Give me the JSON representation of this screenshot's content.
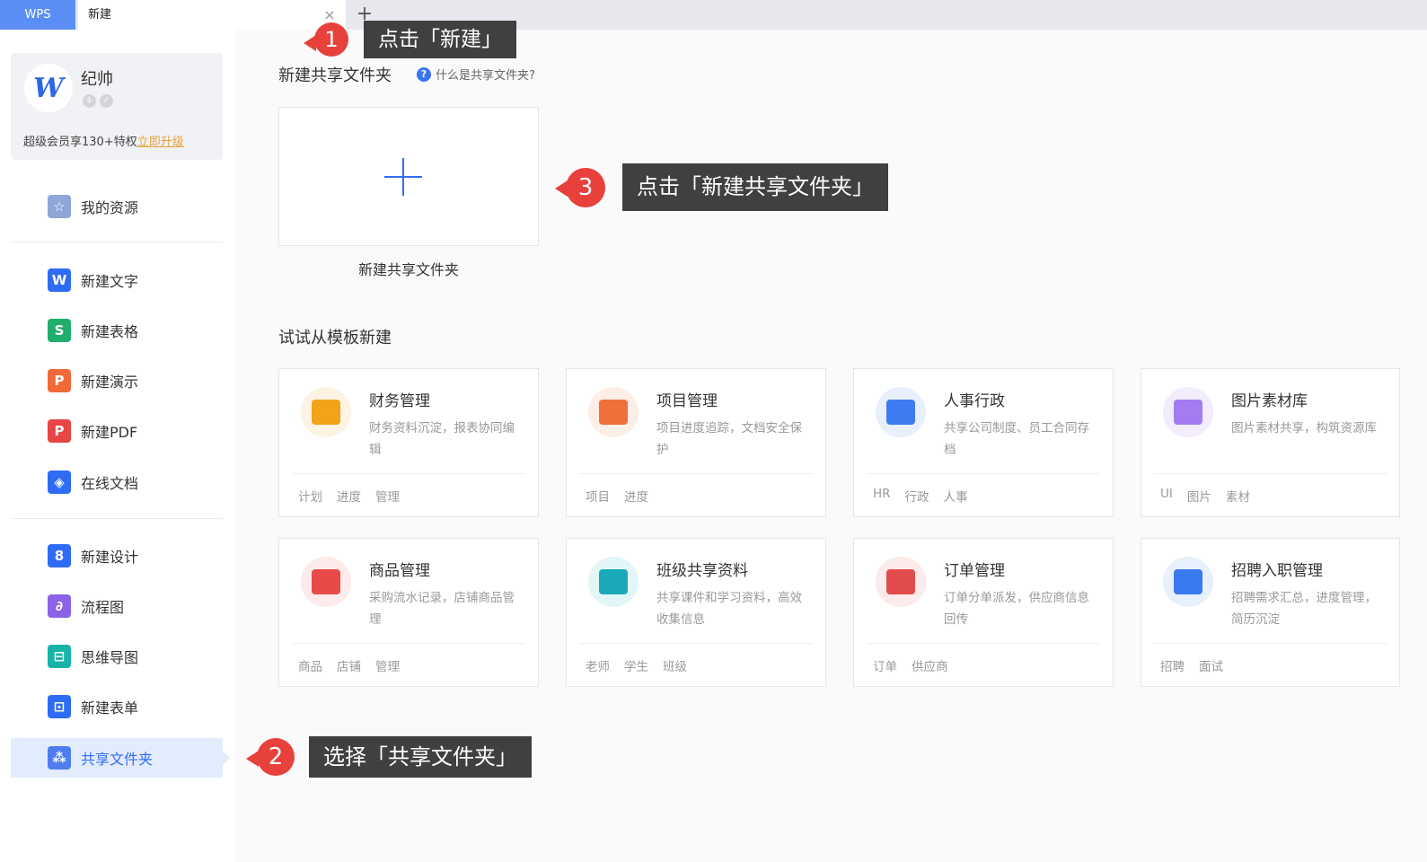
{
  "tabs": {
    "wps_label": "WPS",
    "active_label": "新建",
    "close_icon": "×",
    "add_icon": "+"
  },
  "profile": {
    "username": "纪帅",
    "vip_prefix": "超级会员享130+特权",
    "vip_link": "立即升级"
  },
  "sidebar": {
    "items": [
      {
        "label": "我的资源",
        "icon": "star-icon",
        "color": "#8ea6d8",
        "glyph": "☆"
      },
      {
        "label": "新建文字",
        "icon": "writer-icon",
        "color": "#2f6cf5",
        "glyph": "W"
      },
      {
        "label": "新建表格",
        "icon": "sheet-icon",
        "color": "#1fae6c",
        "glyph": "S"
      },
      {
        "label": "新建演示",
        "icon": "slides-icon",
        "color": "#f26a3a",
        "glyph": "P"
      },
      {
        "label": "新建PDF",
        "icon": "pdf-icon",
        "color": "#e84545",
        "glyph": "P"
      },
      {
        "label": "在线文档",
        "icon": "cloud-doc-icon",
        "color": "#2f6cf5",
        "glyph": "◈"
      },
      {
        "label": "新建设计",
        "icon": "design-icon",
        "color": "#2f6cf5",
        "glyph": "8"
      },
      {
        "label": "流程图",
        "icon": "flowchart-icon",
        "color": "#8a63e6",
        "glyph": "∂"
      },
      {
        "label": "思维导图",
        "icon": "mindmap-icon",
        "color": "#17b3a6",
        "glyph": "⊟"
      },
      {
        "label": "新建表单",
        "icon": "form-icon",
        "color": "#2f6cf5",
        "glyph": "⊡"
      },
      {
        "label": "共享文件夹",
        "icon": "shared-folder-icon",
        "color": "#4f7df0",
        "glyph": "⁂"
      }
    ]
  },
  "main": {
    "shared_title": "新建共享文件夹",
    "help_text": "什么是共享文件夹?",
    "new_card_label": "新建共享文件夹",
    "template_title": "试试从模板新建",
    "templates": [
      {
        "name": "财务管理",
        "desc": "财务资料沉淀，报表协同编辑",
        "tags": [
          "计划",
          "进度",
          "管理"
        ],
        "bg": "#fdf3e2",
        "color": "#f3a319"
      },
      {
        "name": "项目管理",
        "desc": "项目进度追踪，文档安全保护",
        "tags": [
          "项目",
          "进度"
        ],
        "bg": "#fdeee6",
        "color": "#f0703a"
      },
      {
        "name": "人事行政",
        "desc": "共享公司制度、员工合同存档",
        "tags": [
          "HR",
          "行政",
          "人事"
        ],
        "bg": "#e8f0fd",
        "color": "#3c7cf0"
      },
      {
        "name": "图片素材库",
        "desc": "图片素材共享，构筑资源库",
        "tags": [
          "UI",
          "图片",
          "素材"
        ],
        "bg": "#f2ecfd",
        "color": "#a37cf2"
      },
      {
        "name": "商品管理",
        "desc": "采购流水记录，店铺商品管理",
        "tags": [
          "商品",
          "店铺",
          "管理"
        ],
        "bg": "#fdeaea",
        "color": "#e84a4a"
      },
      {
        "name": "班级共享资料",
        "desc": "共享课件和学习资料，高效收集信息",
        "tags": [
          "老师",
          "学生",
          "班级"
        ],
        "bg": "#e3f6f7",
        "color": "#1aa9b8"
      },
      {
        "name": "订单管理",
        "desc": "订单分单派发，供应商信息回传",
        "tags": [
          "订单",
          "供应商"
        ],
        "bg": "#fdeaea",
        "color": "#e24b4b"
      },
      {
        "name": "招聘入职管理",
        "desc": "招聘需求汇总，进度管理，简历沉淀",
        "tags": [
          "招聘",
          "面试"
        ],
        "bg": "#e8f0fd",
        "color": "#3a7af0"
      }
    ]
  },
  "annotations": [
    {
      "number": "1",
      "text": "点击「新建」"
    },
    {
      "number": "2",
      "text": "选择「共享文件夹」"
    },
    {
      "number": "3",
      "text": "点击「新建共享文件夹」"
    }
  ]
}
